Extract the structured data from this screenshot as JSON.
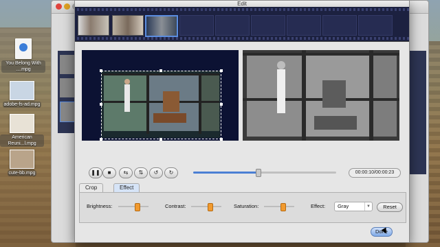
{
  "window": {
    "title": "Edit"
  },
  "desktop": {
    "icons": [
      {
        "label": "You Belong With ....mpg",
        "kind": "file"
      },
      {
        "label": "adobe-fs-ad.mpg",
        "kind": "video"
      },
      {
        "label": "American Reuni...l.mpg",
        "kind": "video"
      },
      {
        "label": "cute-bb.mpg",
        "kind": "video"
      }
    ]
  },
  "playback": {
    "time_display": "00:00:10/00:00:23",
    "progress": 0.45
  },
  "tabs": [
    {
      "label": "Crop"
    },
    {
      "label": "Effect"
    }
  ],
  "active_tab": "Effect",
  "effect_panel": {
    "brightness_label": "Brightness:",
    "contrast_label": "Contrast:",
    "saturation_label": "Saturation:",
    "effect_label": "Effect:",
    "effect_value": "Gray",
    "reset_label": "Reset",
    "brightness_value": 0.62,
    "contrast_value": 0.62,
    "saturation_value": 0.62
  },
  "buttons": {
    "done_label": "Done"
  },
  "icons": {
    "play_pause": "pause-icon",
    "stop": "stop-icon",
    "flip_h": "flip-horizontal-icon",
    "flip_v": "flip-vertical-icon",
    "rotate_ccw": "rotate-left-icon",
    "rotate_cw": "rotate-right-icon"
  },
  "colors": {
    "accent": "#4a7fd4",
    "slider_knob": "#f19a2e",
    "filmstrip_bg": "#1c2140"
  }
}
